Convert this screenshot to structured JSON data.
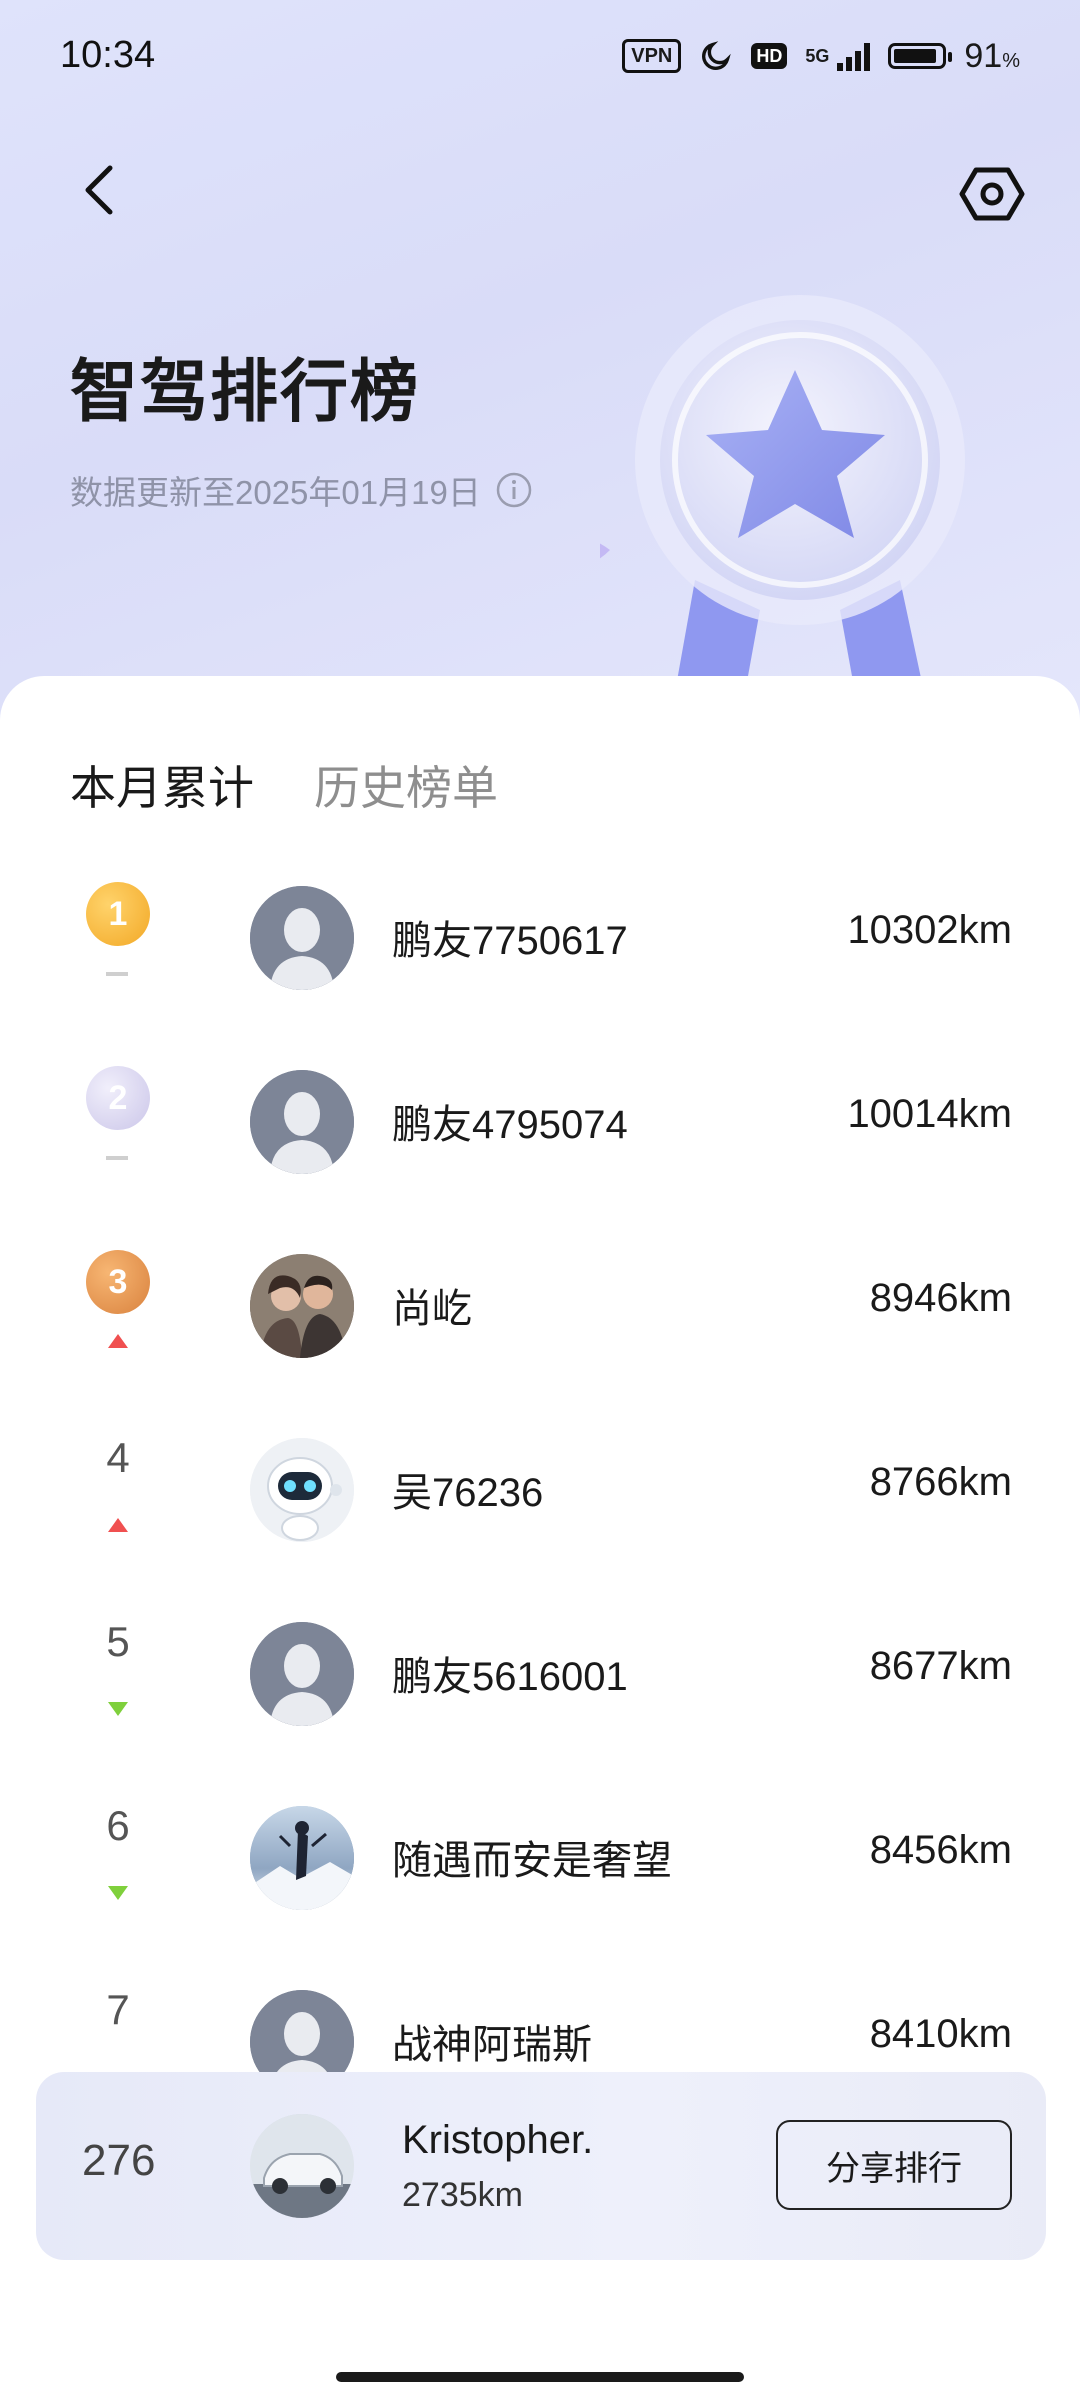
{
  "status_bar": {
    "time": "10:34",
    "vpn": "VPN",
    "hd": "HD",
    "network": "5G",
    "battery_level": 0.91,
    "battery_percent": "91",
    "battery_unit": "%"
  },
  "header": {
    "title": "智驾排行榜",
    "update_text": "数据更新至2025年01月19日",
    "back_icon": "chevron-left-icon",
    "settings_icon": "hexagon-settings-icon",
    "info_icon": "info-circle-icon"
  },
  "tabs": [
    {
      "label": "本月累计",
      "active": true
    },
    {
      "label": "历史榜单",
      "active": false
    }
  ],
  "rankings": [
    {
      "rank": "1",
      "medal": "gold",
      "trend": "same",
      "name": "鹏友7750617",
      "distance": "10302km",
      "avatar": "default"
    },
    {
      "rank": "2",
      "medal": "silver",
      "trend": "same",
      "name": "鹏友4795074",
      "distance": "10014km",
      "avatar": "default"
    },
    {
      "rank": "3",
      "medal": "bronze",
      "trend": "up",
      "name": "尚屹",
      "distance": "8946km",
      "avatar": "photo-couple"
    },
    {
      "rank": "4",
      "medal": "",
      "trend": "up",
      "name": "吴76236",
      "distance": "8766km",
      "avatar": "photo-robot"
    },
    {
      "rank": "5",
      "medal": "",
      "trend": "down",
      "name": "鹏友5616001",
      "distance": "8677km",
      "avatar": "default"
    },
    {
      "rank": "6",
      "medal": "",
      "trend": "down",
      "name": "随遇而安是奢望",
      "distance": "8456km",
      "avatar": "photo-anime"
    },
    {
      "rank": "7",
      "medal": "",
      "trend": "same",
      "name": "战神阿瑞斯",
      "distance": "8410km",
      "avatar": "default"
    }
  ],
  "my_rank": {
    "rank": "276",
    "name": "Kristopher.",
    "distance": "2735km",
    "share_label": "分享排行",
    "avatar": "photo-car"
  },
  "colors": {
    "trend_up": "#f05050",
    "trend_down": "#7fd03c",
    "gold": "#f2a826",
    "silver": "#cbc6e9",
    "bronze": "#d9823e",
    "default_avatar": "#7d8597"
  }
}
